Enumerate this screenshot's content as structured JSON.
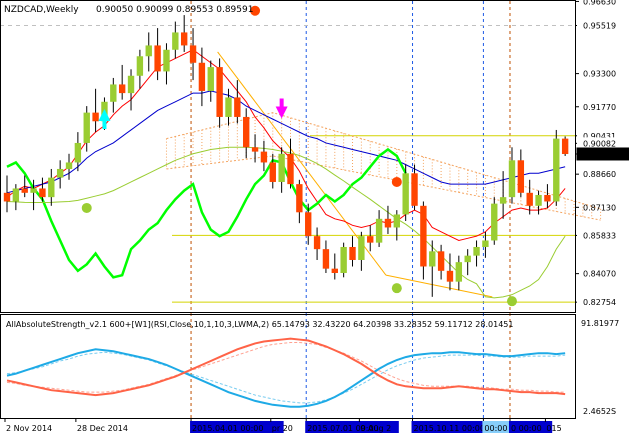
{
  "header": {
    "symbol_line": "NZDCAD,Weekly",
    "ohlc_line": "0.90050 0.90099 0.89553 0.89591"
  },
  "indicator": {
    "label": "AllAbsoluteStrength_v2.1 600+[W1](RSI,Close,10,1,10,3,LWMA,2) 65.14793 32.43220 64.20398 33.28352 59.11712 28.01451",
    "axis_top": "91.81977",
    "axis_bottom": "2.4652S"
  },
  "colors": {
    "bull_candle": "#9ACD32",
    "bear_candle": "#FF4500",
    "tenkan": "#FF0000",
    "kijun": "#0000CD",
    "chikou": "#00FF00",
    "senkou_b": "#F4A460",
    "ma_line": "#9ACD32",
    "strength_bull": "#1EAAE6",
    "strength_bear": "#FF6347",
    "level_line": "#D4D400",
    "fib_line": "#FFB000",
    "grid_dash": "#C0C0C0",
    "vline_red": "#C05000",
    "vline_blue": "#1E5AE6"
  },
  "chart_data": {
    "type": "candlestick",
    "title": "NZDCAD,Weekly",
    "ylim": [
      0.823,
      0.9665
    ],
    "y_ticks": [
      "0.96630",
      "0.95519",
      "0.93300",
      "0.91770",
      "0.90431",
      "0.90082",
      "0.89591",
      "0.88660",
      "0.87130",
      "0.85833",
      "0.84070",
      "0.82754"
    ],
    "y_tick_values": [
      0.9663,
      0.95519,
      0.933,
      0.9177,
      0.90431,
      0.90082,
      0.89591,
      0.8866,
      0.8713,
      0.85833,
      0.8407,
      0.82754
    ],
    "price_labels": [
      {
        "text": "0.95519",
        "value": 0.95519,
        "bg": "#ffffff",
        "fg": "#000000"
      },
      {
        "text": "0.90431",
        "value": 0.90431,
        "bg": "#ffffff",
        "fg": "#000000"
      },
      {
        "text": "0.90082",
        "value": 0.90082,
        "bg": "#ffffff",
        "fg": "#000000"
      },
      {
        "text": "0.89591",
        "value": 0.89591,
        "bg": "#000000",
        "fg": "#ffffff"
      },
      {
        "text": "0.85833",
        "value": 0.85833,
        "bg": "#ffffff",
        "fg": "#000000"
      },
      {
        "text": "0.82754",
        "value": 0.82754,
        "bg": "#ffffff",
        "fg": "#000000"
      }
    ],
    "x_labels": [
      {
        "text": "2 Nov 2014",
        "bar": 0,
        "highlight": false
      },
      {
        "text": "28 Dec 2014",
        "bar": 8,
        "highlight": false
      },
      {
        "text": "2015.04.01 00:00",
        "bar": 21,
        "highlight": true
      },
      {
        "text": "pr 20",
        "bar": 30,
        "highlight": false
      },
      {
        "text": "2015.07.01 00:00",
        "bar": 34,
        "highlight": true
      },
      {
        "text": "9 Aug 2",
        "bar": 40,
        "highlight": false
      },
      {
        "text": "2015.10.11 00:00",
        "bar": 46,
        "highlight": true
      },
      {
        "text": "00:00",
        "bar": 54,
        "highlight": true
      },
      {
        "text": "0 00:00",
        "bar": 57,
        "highlight": true
      },
      {
        "text": "015",
        "bar": 61,
        "highlight": false
      }
    ],
    "candles": [
      [
        0.878,
        0.886,
        0.869,
        0.874
      ],
      [
        0.874,
        0.882,
        0.87,
        0.88
      ],
      [
        0.88,
        0.886,
        0.876,
        0.878
      ],
      [
        0.878,
        0.884,
        0.87,
        0.88
      ],
      [
        0.88,
        0.885,
        0.874,
        0.876
      ],
      [
        0.876,
        0.889,
        0.872,
        0.885
      ],
      [
        0.885,
        0.893,
        0.88,
        0.889
      ],
      [
        0.889,
        0.896,
        0.884,
        0.892
      ],
      [
        0.892,
        0.906,
        0.888,
        0.901
      ],
      [
        0.901,
        0.918,
        0.897,
        0.915
      ],
      [
        0.915,
        0.926,
        0.906,
        0.911
      ],
      [
        0.911,
        0.922,
        0.907,
        0.92
      ],
      [
        0.92,
        0.931,
        0.915,
        0.928
      ],
      [
        0.928,
        0.937,
        0.921,
        0.924
      ],
      [
        0.924,
        0.935,
        0.916,
        0.932
      ],
      [
        0.932,
        0.944,
        0.926,
        0.941
      ],
      [
        0.941,
        0.952,
        0.934,
        0.946
      ],
      [
        0.946,
        0.954,
        0.93,
        0.934
      ],
      [
        0.934,
        0.947,
        0.928,
        0.944
      ],
      [
        0.944,
        0.957,
        0.94,
        0.952
      ],
      [
        0.952,
        0.96,
        0.943,
        0.946
      ],
      [
        0.946,
        0.954,
        0.93,
        0.938
      ],
      [
        0.938,
        0.945,
        0.918,
        0.925
      ],
      [
        0.925,
        0.939,
        0.92,
        0.936
      ],
      [
        0.936,
        0.94,
        0.908,
        0.913
      ],
      [
        0.913,
        0.926,
        0.909,
        0.922
      ],
      [
        0.922,
        0.93,
        0.91,
        0.913
      ],
      [
        0.913,
        0.917,
        0.894,
        0.899
      ],
      [
        0.899,
        0.905,
        0.892,
        0.897
      ],
      [
        0.897,
        0.902,
        0.888,
        0.892
      ],
      [
        0.892,
        0.896,
        0.88,
        0.883
      ],
      [
        0.883,
        0.899,
        0.878,
        0.896
      ],
      [
        0.896,
        0.903,
        0.88,
        0.882
      ],
      [
        0.882,
        0.884,
        0.864,
        0.869
      ],
      [
        0.869,
        0.873,
        0.854,
        0.858
      ],
      [
        0.858,
        0.862,
        0.847,
        0.852
      ],
      [
        0.852,
        0.856,
        0.841,
        0.843
      ],
      [
        0.843,
        0.85,
        0.838,
        0.841
      ],
      [
        0.841,
        0.855,
        0.839,
        0.853
      ],
      [
        0.853,
        0.858,
        0.844,
        0.847
      ],
      [
        0.847,
        0.86,
        0.842,
        0.858
      ],
      [
        0.858,
        0.863,
        0.851,
        0.855
      ],
      [
        0.855,
        0.87,
        0.853,
        0.866
      ],
      [
        0.866,
        0.872,
        0.859,
        0.862
      ],
      [
        0.862,
        0.87,
        0.856,
        0.868
      ],
      [
        0.868,
        0.891,
        0.865,
        0.887
      ],
      [
        0.887,
        0.891,
        0.87,
        0.872
      ],
      [
        0.872,
        0.874,
        0.838,
        0.844
      ],
      [
        0.844,
        0.856,
        0.83,
        0.851
      ],
      [
        0.851,
        0.854,
        0.838,
        0.842
      ],
      [
        0.842,
        0.85,
        0.833,
        0.837
      ],
      [
        0.837,
        0.849,
        0.833,
        0.846
      ],
      [
        0.846,
        0.852,
        0.84,
        0.849
      ],
      [
        0.849,
        0.856,
        0.844,
        0.853
      ],
      [
        0.853,
        0.86,
        0.848,
        0.856
      ],
      [
        0.856,
        0.876,
        0.854,
        0.873
      ],
      [
        0.873,
        0.888,
        0.866,
        0.876
      ],
      [
        0.876,
        0.899,
        0.873,
        0.893
      ],
      [
        0.893,
        0.898,
        0.876,
        0.878
      ],
      [
        0.878,
        0.884,
        0.868,
        0.872
      ],
      [
        0.872,
        0.879,
        0.868,
        0.877
      ],
      [
        0.877,
        0.882,
        0.871,
        0.874
      ],
      [
        0.874,
        0.907,
        0.872,
        0.903
      ],
      [
        0.903,
        0.904,
        0.895,
        0.8959
      ]
    ],
    "series": [
      {
        "key": "tenkan",
        "values": [
          0.876,
          0.879,
          0.881,
          0.88,
          0.882,
          0.884,
          0.887,
          0.89,
          0.896,
          0.902,
          0.906,
          0.909,
          0.914,
          0.918,
          0.921,
          0.926,
          0.931,
          0.936,
          0.938,
          0.94,
          0.942,
          0.944,
          0.941,
          0.938,
          0.935,
          0.93,
          0.925,
          0.92,
          0.913,
          0.908,
          0.902,
          0.898,
          0.894,
          0.888,
          0.88,
          0.874,
          0.868,
          0.866,
          0.865,
          0.863,
          0.862,
          0.863,
          0.865,
          0.864,
          0.865,
          0.868,
          0.87,
          0.868,
          0.862,
          0.86,
          0.858,
          0.856,
          0.857,
          0.858,
          0.86,
          0.864,
          0.867,
          0.87,
          0.871,
          0.87,
          0.87,
          0.871,
          0.875,
          0.88
        ]
      },
      {
        "key": "kijun",
        "values": [
          0.878,
          0.879,
          0.88,
          0.881,
          0.882,
          0.883,
          0.885,
          0.887,
          0.89,
          0.894,
          0.897,
          0.899,
          0.901,
          0.904,
          0.907,
          0.91,
          0.913,
          0.916,
          0.918,
          0.92,
          0.922,
          0.924,
          0.924,
          0.925,
          0.924,
          0.923,
          0.921,
          0.918,
          0.916,
          0.914,
          0.912,
          0.91,
          0.908,
          0.906,
          0.904,
          0.903,
          0.901,
          0.9,
          0.899,
          0.898,
          0.897,
          0.896,
          0.895,
          0.894,
          0.893,
          0.891,
          0.889,
          0.887,
          0.885,
          0.883,
          0.882,
          0.882,
          0.882,
          0.882,
          0.882,
          0.883,
          0.884,
          0.885,
          0.886,
          0.887,
          0.887,
          0.888,
          0.889,
          0.89
        ]
      },
      {
        "key": "chikou",
        "values": [
          0.89,
          0.892,
          0.887,
          0.88,
          0.875,
          0.865,
          0.856,
          0.847,
          0.842,
          0.845,
          0.85,
          0.844,
          0.839,
          0.84,
          0.852,
          0.856,
          0.861,
          0.864,
          0.87,
          0.875,
          0.879,
          0.882,
          0.869,
          0.861,
          0.858,
          0.86,
          0.867,
          0.875,
          0.882,
          0.886,
          0.893,
          0.892,
          0.883,
          0.875,
          0.87,
          0.873,
          0.877,
          0.874,
          0.877,
          0.882,
          0.885,
          0.89,
          0.895,
          0.898,
          0.895,
          0.887
        ]
      },
      {
        "key": "ma",
        "values": [
          0.874,
          0.8738,
          0.8736,
          0.8735,
          0.8735,
          0.8736,
          0.8738,
          0.874,
          0.8745,
          0.8755,
          0.8765,
          0.8775,
          0.879,
          0.881,
          0.883,
          0.885,
          0.887,
          0.889,
          0.891,
          0.893,
          0.8945,
          0.896,
          0.897,
          0.898,
          0.8985,
          0.899,
          0.899,
          0.899,
          0.8988,
          0.8985,
          0.898,
          0.8972,
          0.8964,
          0.8952,
          0.8935,
          0.8915,
          0.889,
          0.8862,
          0.8835,
          0.8806,
          0.8778,
          0.875,
          0.872,
          0.869,
          0.866,
          0.8635,
          0.8605,
          0.857,
          0.853,
          0.849,
          0.845,
          0.841,
          0.838,
          0.836,
          0.83,
          0.8295,
          0.83,
          0.831,
          0.833,
          0.835,
          0.838,
          0.844,
          0.852,
          0.858
        ]
      }
    ],
    "markers": [
      {
        "type": "arrow_up",
        "bar": 11,
        "value": 0.913,
        "color": "#00FFFF"
      },
      {
        "type": "arrow_down",
        "bar": 31,
        "value": 0.916,
        "color": "#FF00FF"
      },
      {
        "type": "dot",
        "bar": 28,
        "value": 0.962,
        "color": "#FF4500"
      },
      {
        "type": "dot",
        "bar": 44,
        "value": 0.883,
        "color": "#FF4500"
      },
      {
        "type": "dot",
        "bar": 9,
        "value": 0.871,
        "color": "#9ACD32"
      },
      {
        "type": "dot",
        "bar": 44,
        "value": 0.834,
        "color": "#9ACD32"
      },
      {
        "type": "dot",
        "bar": 57,
        "value": 0.828,
        "color": "#9ACD32"
      }
    ],
    "strength": {
      "label": "AllAbsoluteStrength_v2.1 600+[W1]",
      "ylim": [
        2.4652,
        91.81977
      ],
      "bull": [
        45,
        47,
        50,
        53,
        56,
        59,
        62,
        65,
        68,
        70,
        72,
        71,
        70,
        68,
        66,
        64,
        62,
        59,
        56,
        52,
        48,
        44,
        40,
        36,
        32,
        28,
        25,
        22,
        19,
        17,
        15,
        14,
        13,
        13,
        14,
        16,
        19,
        23,
        28,
        34,
        40,
        46,
        52,
        57,
        61,
        64,
        66,
        67,
        68,
        68,
        69,
        69,
        68,
        67,
        67,
        66,
        65,
        65,
        66,
        67,
        68,
        68,
        67,
        68
      ],
      "bear": [
        40,
        38,
        36,
        34,
        32,
        30,
        29,
        28,
        27,
        26,
        25,
        26,
        27,
        29,
        31,
        33,
        35,
        38,
        41,
        44,
        48,
        52,
        56,
        60,
        64,
        68,
        72,
        75,
        78,
        80,
        81,
        82,
        83,
        82,
        81,
        78,
        75,
        71,
        67,
        62,
        57,
        51,
        45,
        40,
        36,
        34,
        33,
        32,
        32,
        32,
        33,
        34,
        33,
        32,
        31,
        31,
        30,
        29,
        28,
        28,
        27,
        27,
        27,
        26
      ],
      "bull_signal": [
        47,
        48,
        50,
        52,
        54,
        57,
        60,
        62,
        65,
        67,
        68,
        69,
        68,
        67,
        65,
        63,
        61,
        58,
        55,
        52,
        49,
        46,
        43,
        40,
        37,
        34,
        31,
        28,
        25,
        23,
        21,
        19,
        18,
        17,
        17,
        18,
        20,
        23,
        27,
        31,
        36,
        41,
        46,
        51,
        55,
        58,
        61,
        63,
        64,
        65,
        66,
        66,
        66,
        66,
        65,
        65,
        64,
        64,
        64,
        65,
        65,
        65,
        65,
        66
      ],
      "bear_signal": [
        38,
        37,
        35,
        34,
        33,
        32,
        31,
        30,
        29,
        28,
        28,
        28,
        29,
        30,
        32,
        34,
        36,
        39,
        42,
        45,
        48,
        51,
        54,
        57,
        60,
        63,
        66,
        69,
        72,
        75,
        77,
        78,
        79,
        79,
        78,
        77,
        74,
        71,
        68,
        64,
        60,
        55,
        50,
        46,
        42,
        39,
        37,
        35,
        34,
        34,
        34,
        34,
        34,
        33,
        33,
        32,
        31,
        31,
        30,
        30,
        29,
        29,
        28,
        28
      ]
    }
  }
}
